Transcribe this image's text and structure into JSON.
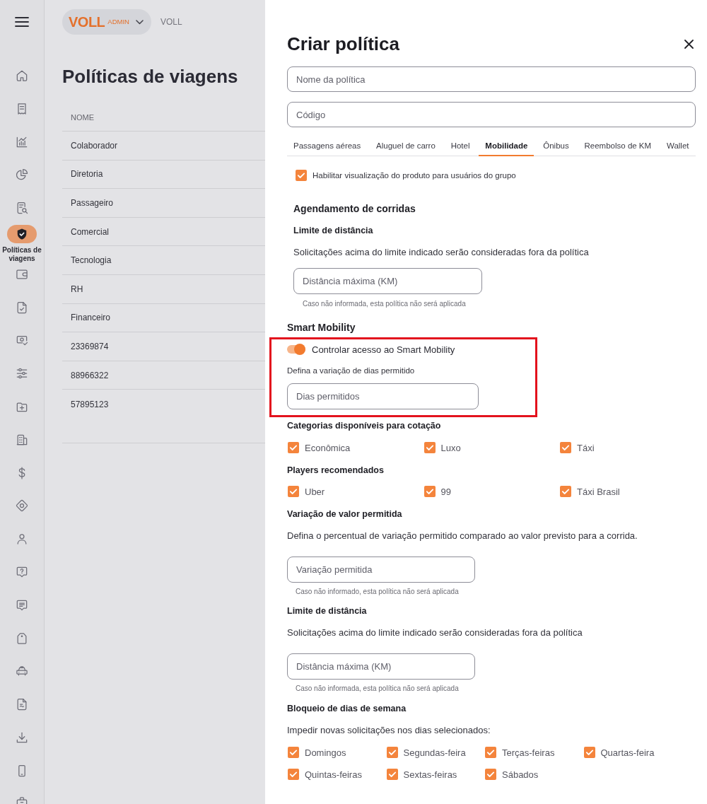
{
  "sidebar": {
    "items": [
      {
        "selected": false
      },
      {
        "selected": false
      },
      {
        "selected": false
      },
      {
        "selected": false
      },
      {
        "selected": false
      },
      {
        "label": "Políticas de viagens",
        "selected": true
      },
      {
        "selected": false
      },
      {
        "selected": false
      },
      {
        "selected": false
      },
      {
        "selected": false
      },
      {
        "selected": false
      },
      {
        "selected": false
      },
      {
        "selected": false
      },
      {
        "selected": false
      },
      {
        "selected": false
      },
      {
        "selected": false
      },
      {
        "selected": false
      },
      {
        "selected": false
      },
      {
        "selected": false
      },
      {
        "selected": false
      },
      {
        "selected": false
      },
      {
        "selected": false
      },
      {
        "selected": false
      }
    ]
  },
  "header": {
    "logo": "VOLL",
    "role": "ADMIN",
    "company": "VOLL"
  },
  "page": {
    "title": "Políticas de viagens",
    "table": {
      "columns": [
        "NOME"
      ],
      "rows": [
        [
          "Colaborador"
        ],
        [
          "Diretoria"
        ],
        [
          "Passageiro"
        ],
        [
          "Comercial"
        ],
        [
          "Tecnologia"
        ],
        [
          "RH"
        ],
        [
          "Financeiro"
        ],
        [
          "23369874"
        ],
        [
          "88966322"
        ],
        [
          "57895123"
        ]
      ]
    }
  },
  "drawer": {
    "title": "Criar política",
    "fields": [
      {
        "placeholder": "Nome da política"
      },
      {
        "placeholder": "Código"
      }
    ],
    "tabs": [
      {
        "label": "Passagens aéreas",
        "selected": false
      },
      {
        "label": "Aluguel de carro",
        "selected": false
      },
      {
        "label": "Hotel",
        "selected": false
      },
      {
        "label": "Mobilidade",
        "selected": true
      },
      {
        "label": "Ônibus",
        "selected": false
      },
      {
        "label": "Reembolso de KM",
        "selected": false
      },
      {
        "label": "Wallet",
        "selected": false
      }
    ],
    "product_visibility": {
      "label": "Habilitar visualização do produto para usuários do grupo",
      "checked": true
    },
    "scheduling": {
      "title": "Agendamento de corridas",
      "subtitle": "Limite de distância",
      "description": "Solicitações acima do limite indicado serão consideradas fora da política",
      "field": {
        "placeholder": "Distância máxima (KM)"
      },
      "hint": "Caso não informada, esta política não será aplicada"
    },
    "smart_mobility": {
      "title": "Smart Mobility",
      "highlighted": true,
      "toggle": {
        "label": "Controlar acesso ao Smart Mobility",
        "on": true
      },
      "days_label": "Defina a variação de dias permitido",
      "days_field": {
        "placeholder": "Dias permitidos"
      }
    },
    "categories": {
      "title": "Categorias disponíveis para cotação",
      "options": [
        {
          "label": "Econômica",
          "checked": true
        },
        {
          "label": "Luxo",
          "checked": true
        },
        {
          "label": "Táxi",
          "checked": true
        }
      ]
    },
    "players": {
      "title": "Players recomendados",
      "options": [
        {
          "label": "Uber",
          "checked": true
        },
        {
          "label": "99",
          "checked": true
        },
        {
          "label": "Táxi Brasil",
          "checked": true
        }
      ]
    },
    "value_variation": {
      "title": "Variação de valor permitida",
      "description": "Defina o percentual de variação permitido comparado ao valor previsto para a corrida.",
      "field": {
        "placeholder": "Variação permitida"
      },
      "hint": "Caso não informado, esta política não será aplicada"
    },
    "distance_limit": {
      "title": "Limite de distância",
      "description": "Solicitações acima do limite indicado serão consideradas fora da política",
      "field": {
        "placeholder": "Distância máxima (KM)"
      },
      "hint": "Caso não informada, esta política não será aplicada"
    },
    "weekday_block": {
      "title": "Bloqueio de dias de semana",
      "description": "Impedir novas solicitações nos dias selecionados:",
      "days": [
        {
          "label": "Domingos",
          "checked": true
        },
        {
          "label": "Segundas-feira",
          "checked": true
        },
        {
          "label": "Terças-feiras",
          "checked": true
        },
        {
          "label": "Quartas-feira",
          "checked": true
        },
        {
          "label": "Quintas-feiras",
          "checked": true
        },
        {
          "label": "Sextas-feiras",
          "checked": true
        },
        {
          "label": "Sábados",
          "checked": true
        }
      ]
    }
  }
}
